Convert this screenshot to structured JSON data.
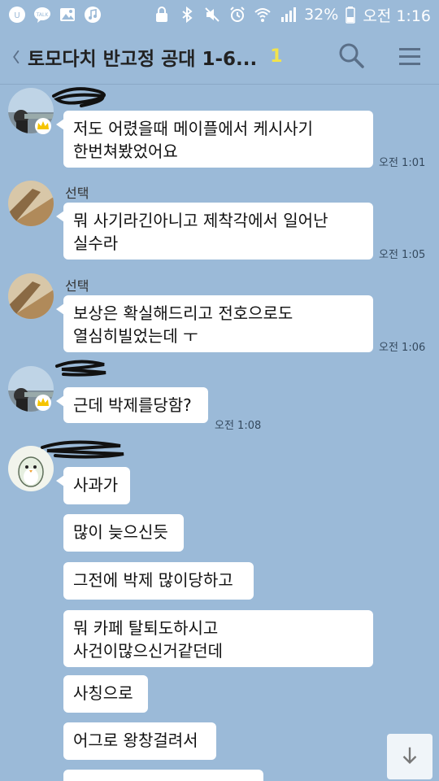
{
  "status_bar": {
    "battery": "32%",
    "time": "오전 1:16"
  },
  "header": {
    "title": "토모다치 반고정 공대 1-6...",
    "member_count": "1"
  },
  "messages": [
    {
      "sender": "",
      "lines": "저도 어렸을때 메이플에서 케시사기\n한번쳐봤었어요",
      "time": "오전 1:01"
    },
    {
      "sender": "선택",
      "lines": "뭐 사기라긴아니고 제착각에서 일어난\n실수라",
      "time": "오전 1:05"
    },
    {
      "sender": "선택",
      "lines": "보상은 확실해드리고 전호으로도\n열심히빌었는데 ㅜ",
      "time": "오전 1:06"
    },
    {
      "sender": "",
      "lines": "근데 박제를당함?",
      "time": "오전 1:08"
    },
    {
      "sender": "",
      "lines": "사과가",
      "time": ""
    },
    {
      "sender": "",
      "lines": "많이 늦으신듯",
      "time": ""
    },
    {
      "sender": "",
      "lines": "그전에 박제 많이당하고",
      "time": ""
    },
    {
      "sender": "",
      "lines": "뭐 카페 탈퇴도하시고\n사건이많으신거같던데",
      "time": ""
    },
    {
      "sender": "",
      "lines": "사칭으로",
      "time": ""
    },
    {
      "sender": "",
      "lines": "어그로 왕창걸려서",
      "time": ""
    }
  ],
  "icons": {
    "back": "back-chevron-icon",
    "search": "search-icon",
    "menu": "menu-icon",
    "scroll_down": "arrow-down-icon"
  }
}
